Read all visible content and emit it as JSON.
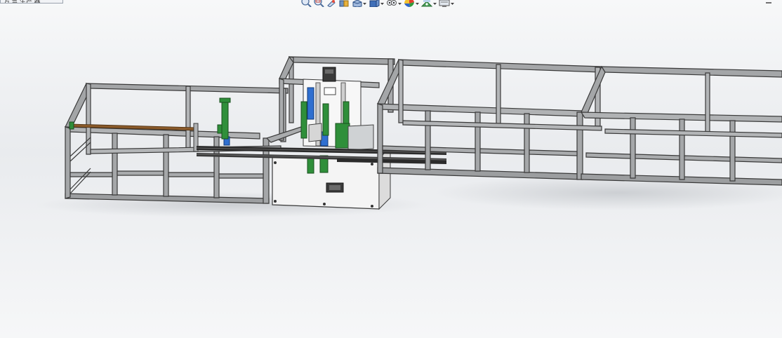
{
  "window": {
    "tab_text": "方 盒 生产 器"
  },
  "toolbar": {
    "buttons": [
      {
        "id": "zoom-to-fit",
        "icon": "zoom-to-fit-icon"
      },
      {
        "id": "zoom-to-area",
        "icon": "zoom-to-area-icon"
      },
      {
        "id": "previous-view",
        "icon": "previous-view-icon"
      },
      {
        "id": "section-view",
        "icon": "section-view-icon"
      },
      {
        "id": "view-orientation",
        "icon": "view-orientation-icon",
        "dropdown": true
      },
      {
        "id": "display-style",
        "icon": "display-style-icon",
        "dropdown": true
      },
      {
        "id": "hide-show-items",
        "icon": "hide-show-items-icon",
        "dropdown": true
      },
      {
        "id": "edit-appearance",
        "icon": "edit-appearance-icon",
        "dropdown": true
      },
      {
        "id": "apply-scene",
        "icon": "apply-scene-icon",
        "dropdown": true
      },
      {
        "id": "view-settings",
        "icon": "view-settings-icon",
        "dropdown": true
      }
    ]
  },
  "colors": {
    "frame_dark": "#3a3a3a",
    "frame_fill": "#9a9c9e",
    "cylinder_green": "#2f8f3a",
    "accent_blue": "#2f6fd0",
    "rail_dark": "#2b2b2b",
    "panel_white": "#f4f4f4",
    "rod_brown": "#8a5a2a"
  }
}
